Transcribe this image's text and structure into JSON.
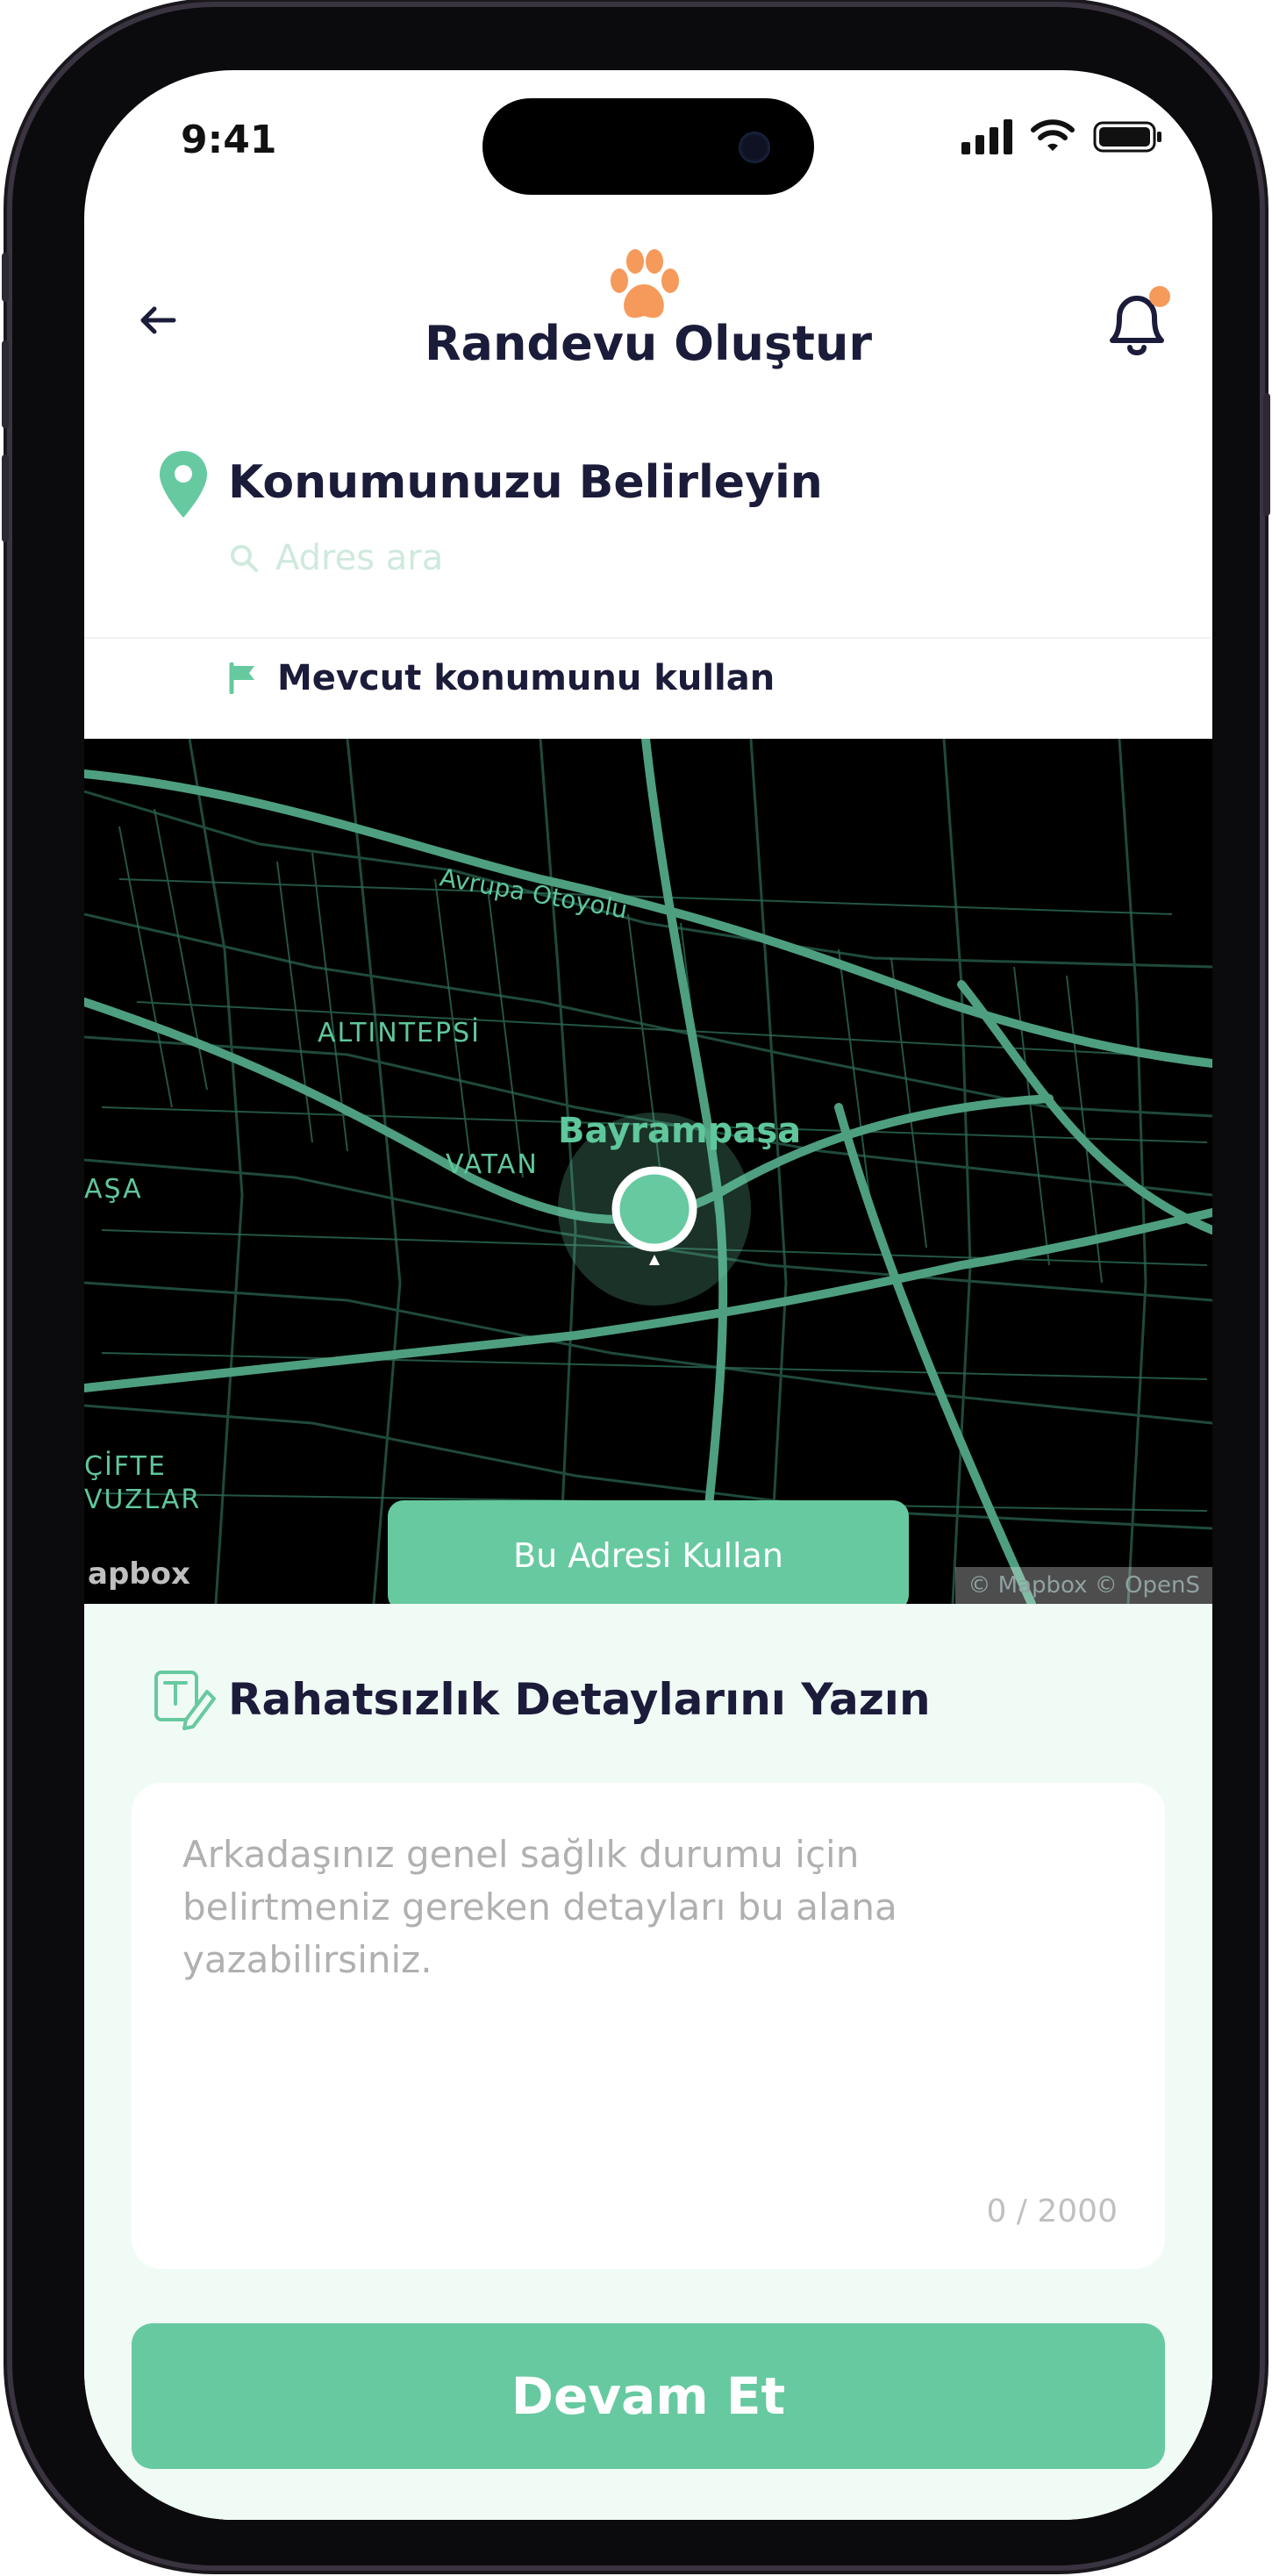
{
  "status_bar": {
    "time": "9:41"
  },
  "header": {
    "title": "Randevu Oluştur"
  },
  "location": {
    "title": "Konumunuzu Belirleyin",
    "search_placeholder": "Adres ara",
    "current_location_label": "Mevcut konumunu kullan"
  },
  "map": {
    "labels": [
      "Avrupa Otoyolu",
      "ALTINTEPSİ",
      "VATAN",
      "Bayrampaşa",
      "AŞA",
      "ÇİFTE",
      "VUZLAR"
    ],
    "use_address_button": "Bu Adresi Kullan",
    "attribution": "© Mapbox © OpenS",
    "brand": "apbox"
  },
  "details": {
    "title": "Rahatsızlık Detaylarını Yazın",
    "placeholder": "Arkadaşınız genel sağlık durumu için belirtmeniz gereken detayları bu alana yazabilirsiniz.",
    "counter": "0 / 2000"
  },
  "footer": {
    "continue_button": "Devam Et"
  },
  "colors": {
    "accent": "#67c9a0",
    "text_dark": "#1b1b3a",
    "notification": "#f59a5b"
  }
}
